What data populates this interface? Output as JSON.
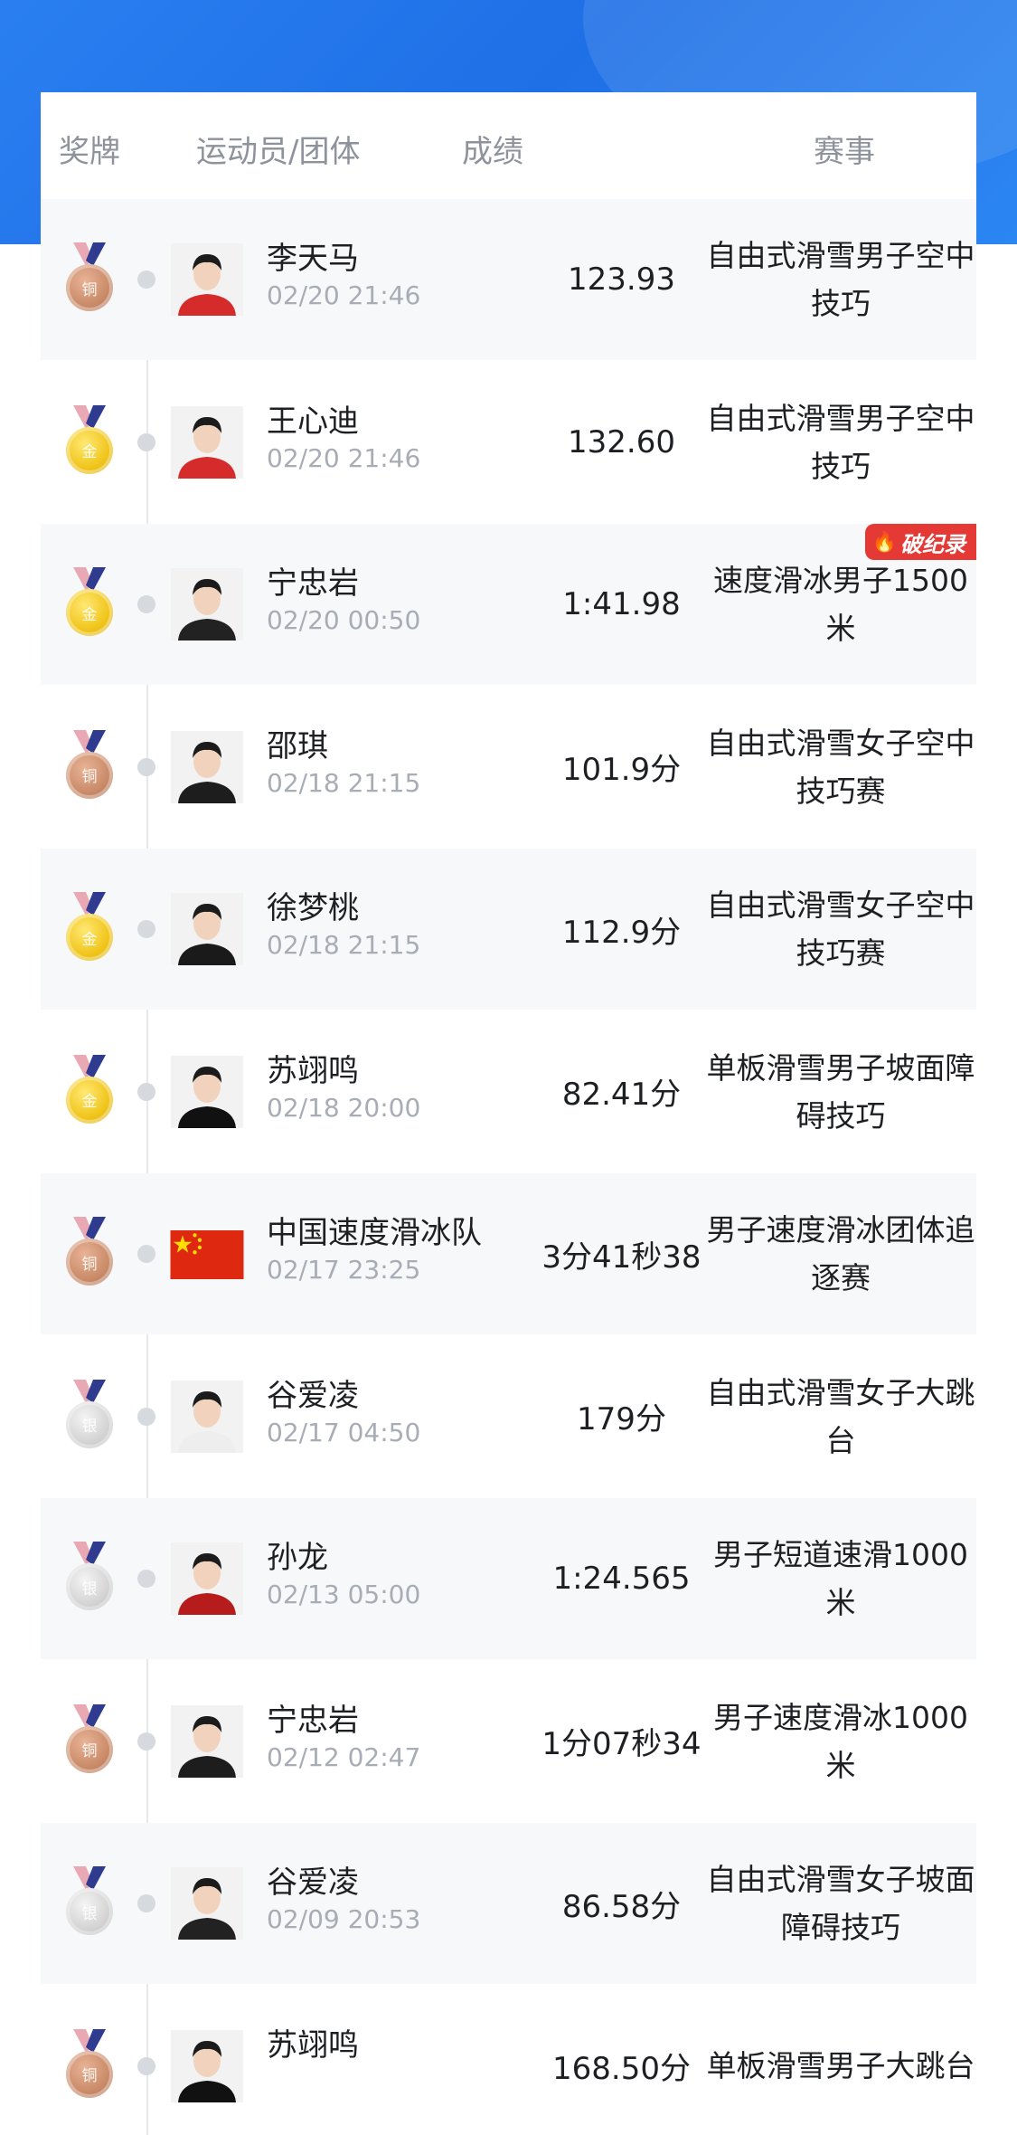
{
  "header": {
    "medal": "奖牌",
    "athlete": "运动员/团体",
    "score": "成绩",
    "event": "赛事"
  },
  "medal_text": {
    "gold": "金",
    "silver": "银",
    "bronze": "铜"
  },
  "colors": {
    "top_band": "#2a7ff0",
    "gold": "#f0c419",
    "silver": "#d3d3d3",
    "bronze": "#c98a68",
    "record_badge": "#e53935"
  },
  "rows": [
    {
      "medal": "bronze",
      "name": "李天马",
      "time": "02/20 21:46",
      "score": "123.93",
      "event": "自由式滑雪男子空中技巧",
      "avatar": "athlete-photo"
    },
    {
      "medal": "gold",
      "name": "王心迪",
      "time": "02/20 21:46",
      "score": "132.60",
      "event": "自由式滑雪男子空中技巧",
      "avatar": "athlete-photo"
    },
    {
      "medal": "gold",
      "name": "宁忠岩",
      "time": "02/20 00:50",
      "score": "1:41.98",
      "event": "速度滑冰男子1500米",
      "avatar": "athlete-photo",
      "badge": "破纪录"
    },
    {
      "medal": "bronze",
      "name": "邵琪",
      "time": "02/18 21:15",
      "score": "101.9分",
      "event": "自由式滑雪女子空中技巧赛",
      "avatar": "athlete-photo"
    },
    {
      "medal": "gold",
      "name": "徐梦桃",
      "time": "02/18 21:15",
      "score": "112.9分",
      "event": "自由式滑雪女子空中技巧赛",
      "avatar": "athlete-photo"
    },
    {
      "medal": "gold",
      "name": "苏翊鸣",
      "time": "02/18 20:00",
      "score": "82.41分",
      "event": "单板滑雪男子坡面障碍技巧",
      "avatar": "athlete-photo"
    },
    {
      "medal": "bronze",
      "name": "中国速度滑冰队",
      "time": "02/17 23:25",
      "score": "3分41秒38",
      "event": "男子速度滑冰团体追逐赛",
      "avatar": "china-flag"
    },
    {
      "medal": "silver",
      "name": "谷爱凌",
      "time": "02/17 04:50",
      "score": "179分",
      "event": "自由式滑雪女子大跳台",
      "avatar": "athlete-photo"
    },
    {
      "medal": "silver",
      "name": "孙龙",
      "time": "02/13 05:00",
      "score": "1:24.565",
      "event": "男子短道速滑1000米",
      "avatar": "athlete-photo"
    },
    {
      "medal": "bronze",
      "name": "宁忠岩",
      "time": "02/12 02:47",
      "score": "1分07秒34",
      "event": "男子速度滑冰1000米",
      "avatar": "athlete-photo"
    },
    {
      "medal": "silver",
      "name": "谷爱凌",
      "time": "02/09 20:53",
      "score": "86.58分",
      "event": "自由式滑雪女子坡面障碍技巧",
      "avatar": "athlete-photo"
    },
    {
      "medal": "bronze",
      "name": "苏翊鸣",
      "time": "",
      "score": "168.50分",
      "event": "单板滑雪男子大跳台",
      "avatar": "athlete-photo"
    }
  ]
}
